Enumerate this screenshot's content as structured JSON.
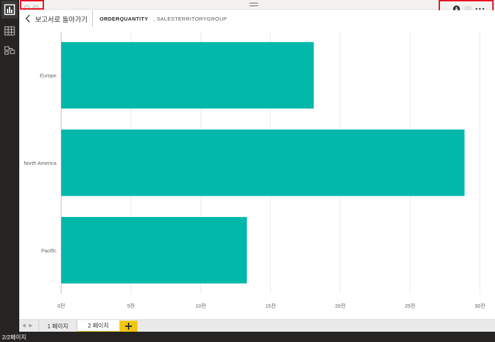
{
  "header": {
    "back_label": "보고서로 돌아가기",
    "field_name": "ORDERQUANTITY",
    "field_group": ", SALESTERRITORYGROUP"
  },
  "icons": {
    "rail": [
      "report-view-icon",
      "data-view-icon",
      "relationships-view-icon"
    ],
    "top_left": [
      "undo-icon",
      "redo-icon"
    ],
    "top_right": [
      "download-icon",
      "focus-icon",
      "more-options-icon"
    ]
  },
  "colors": {
    "bar": "#01b8aa",
    "accent": "#f2c80f",
    "highlight": "#e81123",
    "rail": "#252423"
  },
  "chart_data": {
    "type": "bar",
    "orientation": "horizontal",
    "categories": [
      "Europe",
      "North America",
      "Pacific"
    ],
    "values": [
      18100,
      28900,
      13300
    ],
    "xlim": [
      0,
      30000
    ],
    "ticks": [
      0,
      5000,
      10000,
      15000,
      20000,
      25000,
      30000
    ],
    "tick_labels": [
      "0천",
      "5천",
      "10천",
      "15천",
      "20천",
      "25천",
      "30천"
    ],
    "grid": true
  },
  "pages": {
    "tabs": [
      "1 페이지",
      "2 페이지"
    ],
    "active": 1,
    "add_label": "+"
  },
  "status": {
    "text": "2/2페이지"
  }
}
